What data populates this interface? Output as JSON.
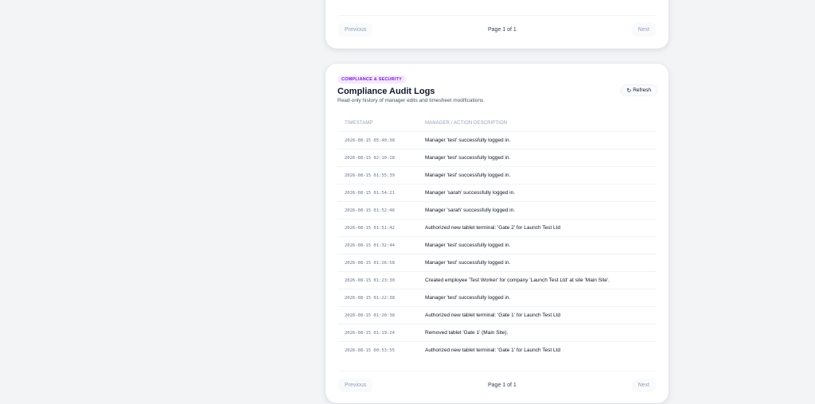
{
  "top_card": {
    "pagination": {
      "previous": "Previous",
      "info": "Page 1 of 1",
      "next": "Next"
    }
  },
  "audit": {
    "badge": "COMPLIANCE & SECURITY",
    "title": "Compliance Audit Logs",
    "subtitle": "Read-only history of manager edits and timesheet modifications.",
    "refresh_label": "Refresh",
    "refresh_icon": "↻",
    "columns": {
      "timestamp": "TIMESTAMP",
      "description": "MANAGER / ACTION DESCRIPTION"
    },
    "rows": [
      {
        "ts": "2026-08-15 05:40:38",
        "desc": "Manager 'test' successfully logged in."
      },
      {
        "ts": "2026-08-15 02:10:18",
        "desc": "Manager 'test' successfully logged in."
      },
      {
        "ts": "2026-08-15 01:55:39",
        "desc": "Manager 'test' successfully logged in."
      },
      {
        "ts": "2026-08-15 01:54:21",
        "desc": "Manager 'sarah' successfully logged in."
      },
      {
        "ts": "2026-08-15 01:52:46",
        "desc": "Manager 'sarah' successfully logged in."
      },
      {
        "ts": "2026-08-15 01:51:42",
        "desc": "Authorized new tablet terminal: 'Gate 2' for Launch Test Ltd"
      },
      {
        "ts": "2026-08-15 01:32:44",
        "desc": "Manager 'test' successfully logged in."
      },
      {
        "ts": "2026-08-15 01:26:58",
        "desc": "Manager 'test' successfully logged in."
      },
      {
        "ts": "2026-08-15 01:23:30",
        "desc": "Created employee 'Test Worker' for company 'Launch Test Ltd' at site 'Main Site'."
      },
      {
        "ts": "2026-08-15 01:22:38",
        "desc": "Manager 'test' successfully logged in."
      },
      {
        "ts": "2026-08-15 01:20:38",
        "desc": "Authorized new tablet terminal: 'Gate 1' for Launch Test Ltd"
      },
      {
        "ts": "2026-08-15 01:19:24",
        "desc": "Removed tablet 'Gate 1' (Main Site)."
      },
      {
        "ts": "2026-08-15 00:53:55",
        "desc": "Authorized new tablet terminal: 'Gate 1' for Launch Test Ltd"
      }
    ],
    "pagination": {
      "previous": "Previous",
      "info": "Page 1 of 1",
      "next": "Next"
    }
  }
}
